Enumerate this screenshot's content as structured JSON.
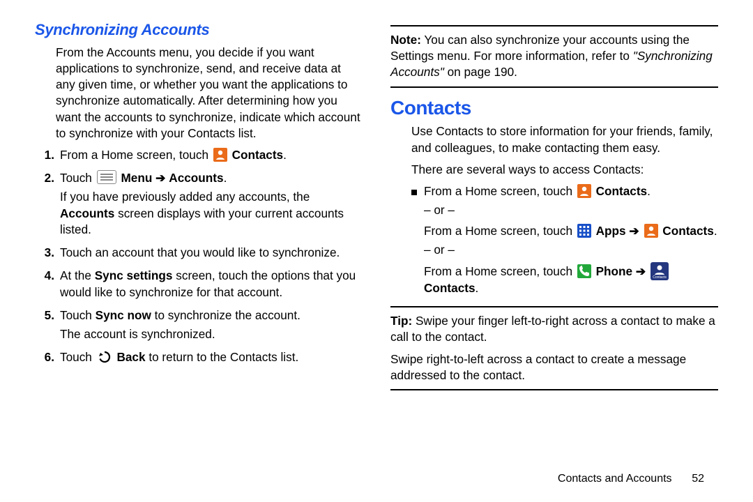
{
  "left": {
    "heading": "Synchronizing Accounts",
    "intro": "From the Accounts menu, you decide if you want applications to synchronize, send, and receive data at any given time, or whether you want the applications to synchronize automatically. After determining how you want the accounts to synchronize, indicate which account to synchronize with your Contacts list.",
    "step1_a": "From a Home screen, touch",
    "step1_b": "Contacts",
    "step2_a": "Touch",
    "step2_b": "Menu",
    "step2_c": "Accounts",
    "step2_more_a": "If you have previously added any accounts, the",
    "step2_more_b": "Accounts",
    "step2_more_c": "screen displays with your current accounts listed.",
    "step3": "Touch an account that you would like to synchronize.",
    "step4_a": "At the",
    "step4_b": "Sync settings",
    "step4_c": "screen, touch the options that you would like to synchronize for that account.",
    "step5_a": "Touch",
    "step5_b": "Sync now",
    "step5_c": "to synchronize the account.",
    "step5_more": "The account is synchronized.",
    "step6_a": "Touch",
    "step6_b": "Back",
    "step6_c": "to return to the Contacts list."
  },
  "right": {
    "note_label": "Note:",
    "note_a": "You can also synchronize your accounts using the Settings menu. For more information, refer to",
    "note_b": "\"Synchronizing Accounts\"",
    "note_c": "on page 190.",
    "heading": "Contacts",
    "intro1": "Use Contacts to store information for your friends, family, and colleagues, to make contacting them easy.",
    "intro2": "There are several ways to access Contacts:",
    "way1_a": "From a Home screen, touch",
    "way1_b": "Contacts",
    "or": "– or –",
    "way2_a": "From a Home screen, touch",
    "way2_b": "Apps",
    "way2_c": "Contacts",
    "way3_a": "From a Home screen, touch",
    "way3_b": "Phone",
    "way3_c": "Contacts",
    "tip_label": "Tip:",
    "tip_a": "Swipe your finger left-to-right across a contact to make a call to the contact.",
    "tip_b": "Swipe right-to-left across a contact to create a message addressed to the contact."
  },
  "footer": {
    "section": "Contacts and Accounts",
    "page": "52"
  },
  "glyphs": {
    "arrow": "➔",
    "period": "."
  },
  "icons": {
    "contacts_caption": "Contacts"
  }
}
